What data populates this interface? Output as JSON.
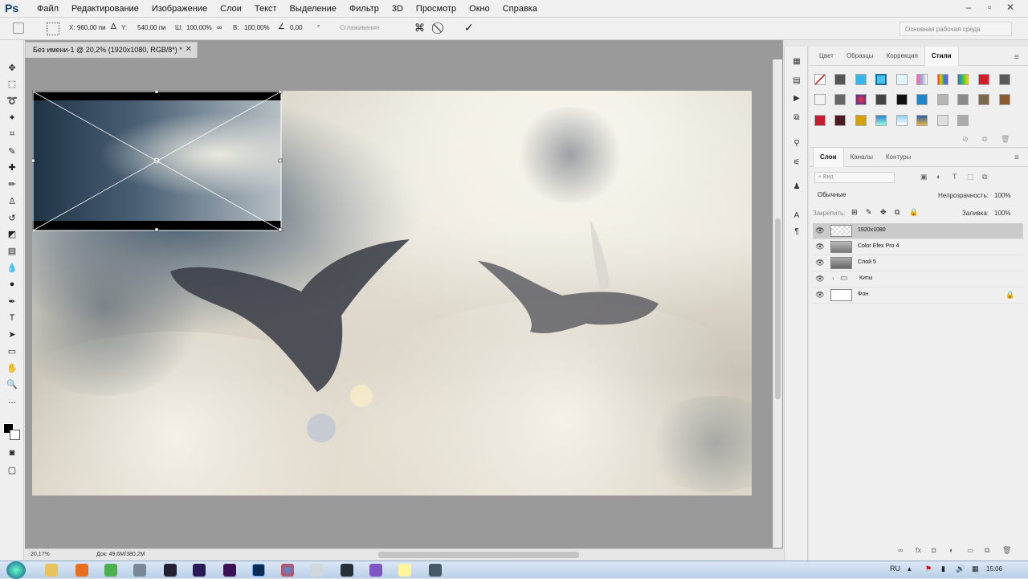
{
  "app": {
    "logo": "Ps"
  },
  "menu": [
    "Файл",
    "Редактирование",
    "Изображение",
    "Слои",
    "Текст",
    "Выделение",
    "Фильтр",
    "3D",
    "Просмотр",
    "Окно",
    "Справка"
  ],
  "options": {
    "x_label": "X:",
    "x_value": "960,00 пи",
    "y_label": "Y:",
    "y_value": "540,00 пи",
    "w_label": "Ш:",
    "w_value": "100,00%",
    "h_label": "В:",
    "h_value": "100,00%",
    "angle_value": "0,00",
    "interp_label": "°",
    "smoothing_label": "Сглаживание",
    "workspace": "Основная рабочая среда"
  },
  "document": {
    "tab_title": "Без имени-1 @ 20,2% (1920x1080, RGB/8*) *"
  },
  "status": {
    "zoom": "20,17%",
    "doc_size": "Док: 49,6M/380,2M"
  },
  "panel_top": {
    "tabs": [
      "Цвет",
      "Образцы",
      "Коррекция",
      "Стили"
    ],
    "active_tab": "Стили"
  },
  "layers_panel": {
    "tabs": [
      "Слои",
      "Каналы",
      "Контуры"
    ],
    "filter_placeholder": "Вид",
    "blend_mode": "Обычные",
    "opacity_label": "Непрозрачность:",
    "opacity_value": "100%",
    "lock_label": "Закрепить:",
    "fill_label": "Заливка:",
    "fill_value": "100%",
    "layers": [
      {
        "name": "1920x1080",
        "selected": true
      },
      {
        "name": "Color Efex Pro 4",
        "selected": false
      },
      {
        "name": "Слой 5",
        "selected": false
      },
      {
        "name": "Киты",
        "selected": false,
        "group": true
      },
      {
        "name": "Фон",
        "selected": false,
        "locked": true
      }
    ]
  },
  "taskbar": {
    "lang": "RU",
    "time": "15:06"
  },
  "colors": {
    "selection_bg": "#cacaca",
    "menu_bg": "#f0f0f0",
    "canvas_bg": "#9a9a9a"
  }
}
